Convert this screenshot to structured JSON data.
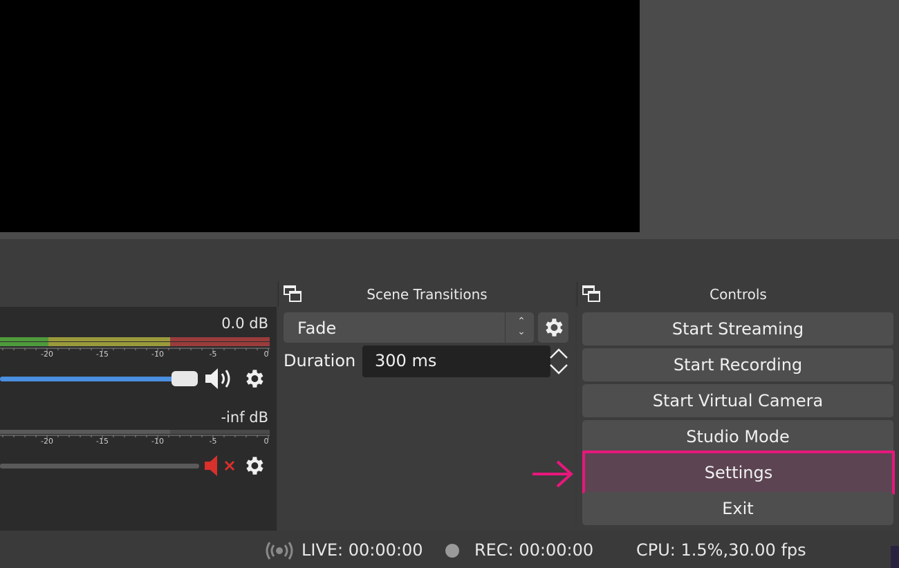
{
  "docks": {
    "transitions_title": "Scene Transitions",
    "controls_title": "Controls"
  },
  "mixer": {
    "channels": [
      {
        "level": "0.0 dB",
        "muted": false,
        "volume": 1.0
      },
      {
        "level": "-inf dB",
        "muted": true,
        "volume": 1.0
      }
    ],
    "scale_ticks": [
      "-20",
      "-15",
      "-10",
      "-5",
      "0"
    ]
  },
  "transitions": {
    "selected": "Fade",
    "duration_label": "Duration",
    "duration_value": "300 ms"
  },
  "controls": {
    "start_streaming": "Start Streaming",
    "start_recording": "Start Recording",
    "start_virtual_camera": "Start Virtual Camera",
    "studio_mode": "Studio Mode",
    "settings": "Settings",
    "exit": "Exit"
  },
  "status": {
    "live": "LIVE: 00:00:00",
    "rec": "REC: 00:00:00",
    "cpu": "CPU: 1.5%,30.00 fps"
  },
  "colors": {
    "highlight": "#e8177c",
    "meter_green": "#4f9a3c",
    "meter_yellow": "#9a9a3c",
    "meter_red": "#9a3c3c",
    "fader_blue": "#4a8fe0",
    "mute_red": "#d9302c"
  }
}
